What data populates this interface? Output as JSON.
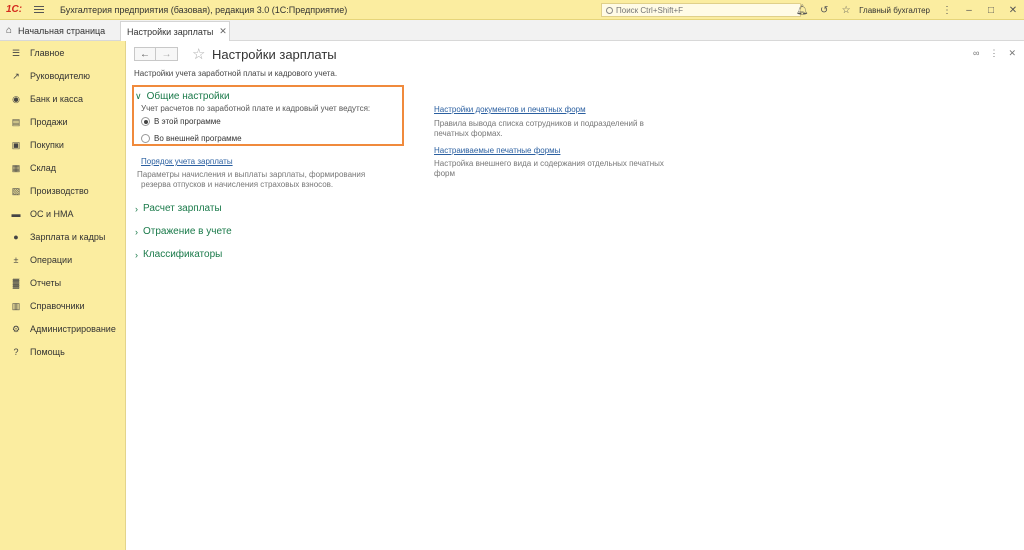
{
  "titlebar": {
    "logo": "1С:",
    "title": "Бухгалтерия предприятия (базовая), редакция 3.0  (1С:Предприятие)",
    "search_placeholder": "Поиск Ctrl+Shift+F",
    "user": "Главный бухгалтер",
    "icons": [
      "bell-icon",
      "history-icon",
      "star-icon",
      "menu-icon",
      "minimize-icon",
      "restore-icon",
      "close-icon"
    ]
  },
  "tabs": {
    "home_label": "Начальная страница",
    "active_label": "Настройки зарплаты"
  },
  "sidebar": {
    "items": [
      {
        "label": "Главное",
        "icon": "list-icon"
      },
      {
        "label": "Руководителю",
        "icon": "trend-icon"
      },
      {
        "label": "Банк и касса",
        "icon": "coin-icon"
      },
      {
        "label": "Продажи",
        "icon": "bag-icon"
      },
      {
        "label": "Покупки",
        "icon": "cart-icon"
      },
      {
        "label": "Склад",
        "icon": "warehouse-icon"
      },
      {
        "label": "Производство",
        "icon": "factory-icon"
      },
      {
        "label": "ОС и НМА",
        "icon": "truck-icon"
      },
      {
        "label": "Зарплата и кадры",
        "icon": "person-icon"
      },
      {
        "label": "Операции",
        "icon": "operations-icon"
      },
      {
        "label": "Отчеты",
        "icon": "report-icon"
      },
      {
        "label": "Справочники",
        "icon": "books-icon"
      },
      {
        "label": "Администрирование",
        "icon": "gear-icon"
      },
      {
        "label": "Помощь",
        "icon": "help-icon"
      }
    ]
  },
  "main": {
    "title": "Настройки зарплаты",
    "subtitle": "Настройки учета заработной платы и кадрового учета.",
    "general": {
      "heading": "Общие настройки",
      "note": "Учет расчетов по заработной плате и кадровый учет ведутся:",
      "option_internal": "В этой программе",
      "option_external": "Во внешней программе",
      "selected": "option_internal"
    },
    "order_link": "Порядок учета зарплаты",
    "order_desc_1": "Параметры начисления и выплаты зарплаты, формирования",
    "order_desc_2": "резерва отпусков и начисления страховых взносов.",
    "sections": [
      "Расчет зарплаты",
      "Отражение в учете",
      "Классификаторы"
    ],
    "right": {
      "docs_link": "Настройки документов и печатных форм",
      "docs_desc_1": "Правила вывода списка сотрудников и подразделений в",
      "docs_desc_2": "печатных формах.",
      "print_link": "Настраиваемые печатные формы",
      "print_desc_1": "Настройка внешнего вида и содержания отдельных печатных",
      "print_desc_2": "форм"
    }
  }
}
